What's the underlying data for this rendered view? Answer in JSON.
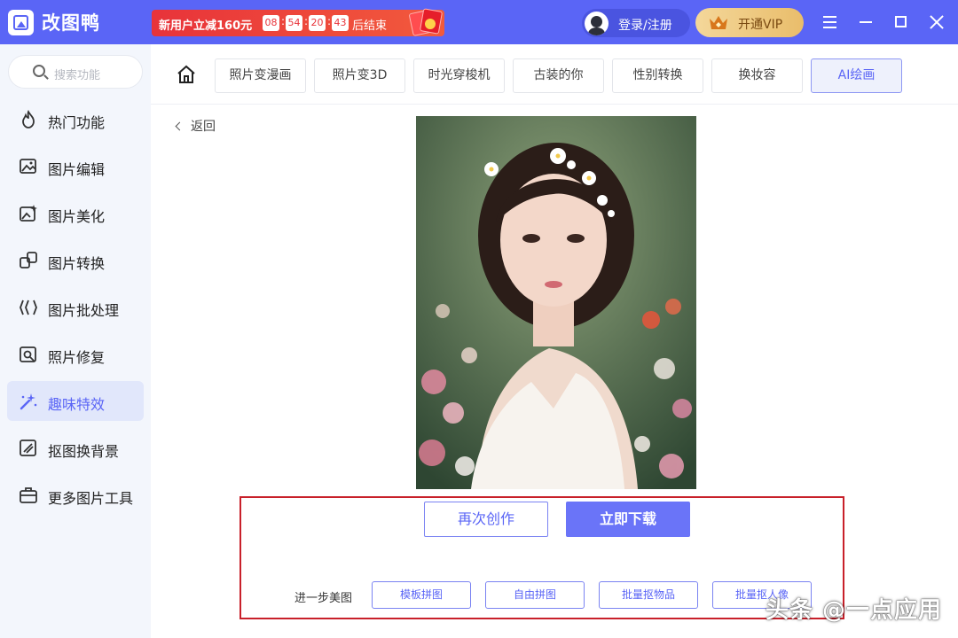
{
  "app": {
    "name": "改图鸭"
  },
  "promo": {
    "text": "新用户立减160元",
    "countdown": [
      "08",
      "54",
      "20",
      "43"
    ],
    "suffix": "后结束"
  },
  "header": {
    "login_label": "登录/注册",
    "vip_label": "开通VIP"
  },
  "sidebar": {
    "search_placeholder": "搜索功能",
    "items": [
      {
        "label": "热门功能",
        "icon": "fire-icon"
      },
      {
        "label": "图片编辑",
        "icon": "image-edit-icon"
      },
      {
        "label": "图片美化",
        "icon": "image-beautify-icon"
      },
      {
        "label": "图片转换",
        "icon": "image-convert-icon"
      },
      {
        "label": "图片批处理",
        "icon": "batch-process-icon"
      },
      {
        "label": "照片修复",
        "icon": "photo-repair-icon"
      },
      {
        "label": "趣味特效",
        "icon": "magic-wand-icon",
        "active": true
      },
      {
        "label": "抠图换背景",
        "icon": "cutout-icon"
      },
      {
        "label": "更多图片工具",
        "icon": "toolbox-icon"
      }
    ]
  },
  "tabs": [
    {
      "label": "照片变漫画"
    },
    {
      "label": "照片变3D"
    },
    {
      "label": "时光穿梭机"
    },
    {
      "label": "古装的你"
    },
    {
      "label": "性别转换"
    },
    {
      "label": "换妆容"
    },
    {
      "label": "AI绘画",
      "active": true
    }
  ],
  "main": {
    "back_label": "返回",
    "again_label": "再次创作",
    "download_label": "立即下载",
    "further_label": "进一步美图",
    "tools": [
      "模板拼图",
      "自由拼图",
      "批量抠物品",
      "批量抠人像"
    ]
  },
  "watermark": "头条 @一点应用",
  "colors": {
    "primary": "#5a65f6",
    "promo": "#e8333a",
    "vip": "#e9bd6b",
    "highlight_border": "#c8202a"
  }
}
